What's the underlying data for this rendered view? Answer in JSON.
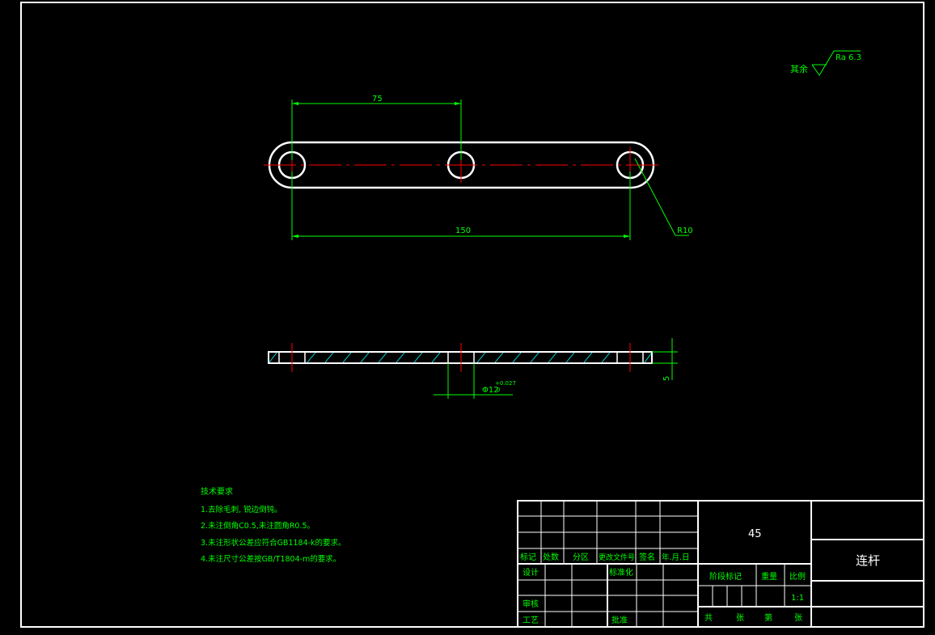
{
  "roughness": {
    "prefix": "其余",
    "value": "Ra 6.3"
  },
  "dimensions": {
    "d75": "75",
    "d150": "150",
    "r10": "R10",
    "thickness": "5",
    "hole_dia": "Φ12",
    "hole_tol_upper": "+0.027",
    "hole_tol_lower": "0"
  },
  "tech_requirements": {
    "title": "技术要求",
    "items": [
      "1.去除毛刺, 锐边倒钝。",
      "2.未注倒角C0.5,未注圆角R0.5。",
      "3.未注形状公差应符合GB1184-k的要求。",
      "4.未注尺寸公差按GB/T1804-m的要求。"
    ]
  },
  "title_block": {
    "material": "45",
    "part_name": "连杆",
    "scale": "1:1",
    "headers": {
      "mark": "标记",
      "count": "处数",
      "zone": "分区",
      "change_doc": "更改文件号",
      "signature": "签名",
      "date": "年.月.日"
    },
    "rows": {
      "design": "设计",
      "standardize": "标准化",
      "review": "审核",
      "process": "工艺",
      "approve": "批准"
    },
    "stage_mark": "阶段标记",
    "weight": "重量",
    "scale_label": "比例",
    "total_label": "共",
    "sheet_label": "张",
    "page_label": "第",
    "page_sheet_label": "张"
  },
  "colors": {
    "outline": "#ffffff",
    "dimension": "#00ff00",
    "centerline": "#ff0000",
    "text": "#00ff00",
    "hatch": "#00ffff",
    "background": "#000000"
  }
}
